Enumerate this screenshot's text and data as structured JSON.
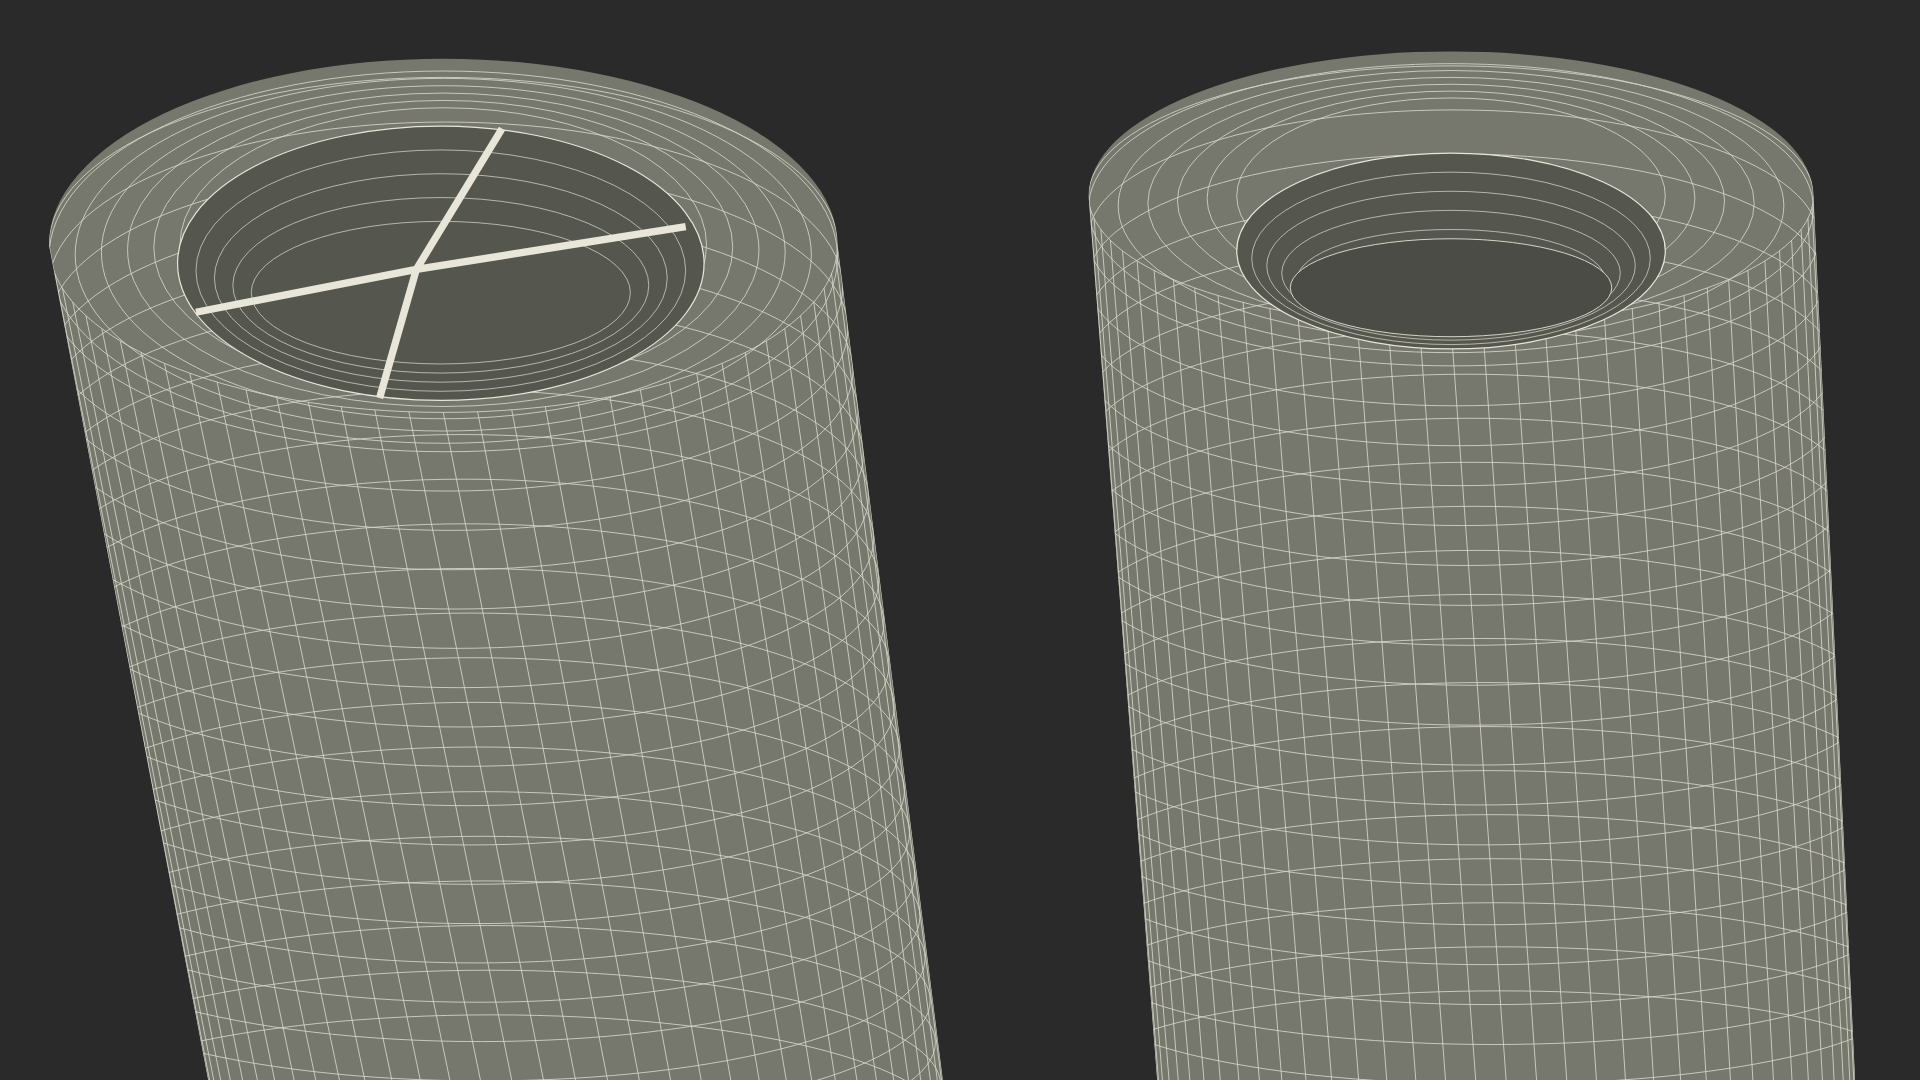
{
  "objects": [
    {
      "kind": "open-top"
    },
    {
      "kind": "ring-top"
    }
  ]
}
